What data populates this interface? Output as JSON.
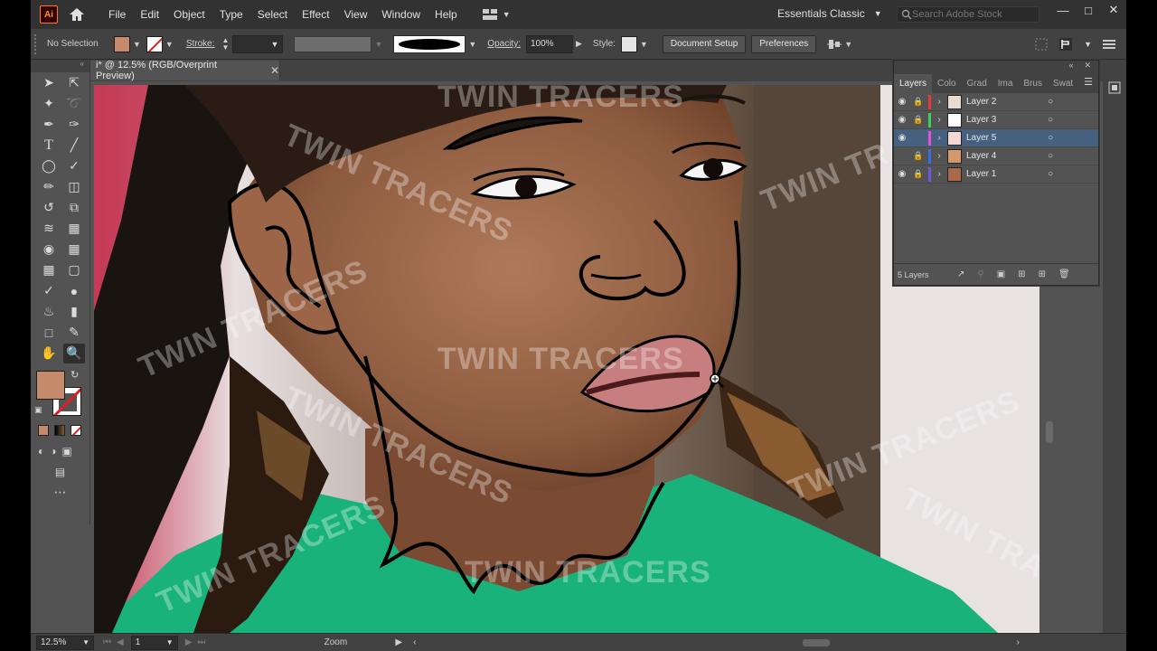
{
  "menubar": {
    "app_logo": "Ai",
    "items": [
      "File",
      "Edit",
      "Object",
      "Type",
      "Select",
      "Effect",
      "View",
      "Window",
      "Help"
    ],
    "workspace": "Essentials Classic",
    "stock_placeholder": "Search Adobe Stock"
  },
  "control": {
    "selection_label": "No Selection",
    "stroke_label": "Stroke:",
    "opacity_label": "Opacity:",
    "opacity_value": "100%",
    "style_label": "Style:",
    "doc_setup_label": "Document Setup",
    "preferences_label": "Preferences",
    "fill_color": "#c48a6a"
  },
  "document": {
    "tab_title": "i* @ 12.5% (RGB/Overprint Preview)"
  },
  "layers_panel": {
    "tabs": [
      "Layers",
      "Colo",
      "Grad",
      "Ima",
      "Brus",
      "Swat"
    ],
    "layers": [
      {
        "name": "Layer 2",
        "color": "#e83b3b",
        "visible": true,
        "locked": true,
        "selected": false
      },
      {
        "name": "Layer 3",
        "color": "#3bd15a",
        "visible": true,
        "locked": true,
        "selected": false
      },
      {
        "name": "Layer 5",
        "color": "#e84fd6",
        "visible": true,
        "locked": false,
        "selected": true
      },
      {
        "name": "Layer 4",
        "color": "#3b6de8",
        "visible": false,
        "locked": true,
        "selected": false
      },
      {
        "name": "Layer 1",
        "color": "#6b59e0",
        "visible": true,
        "locked": true,
        "selected": false
      }
    ],
    "count_label": "5 Layers"
  },
  "status": {
    "zoom": "12.5%",
    "artboard": "1",
    "tool_label": "Zoom"
  },
  "watermark": "TWIN TRACERS"
}
